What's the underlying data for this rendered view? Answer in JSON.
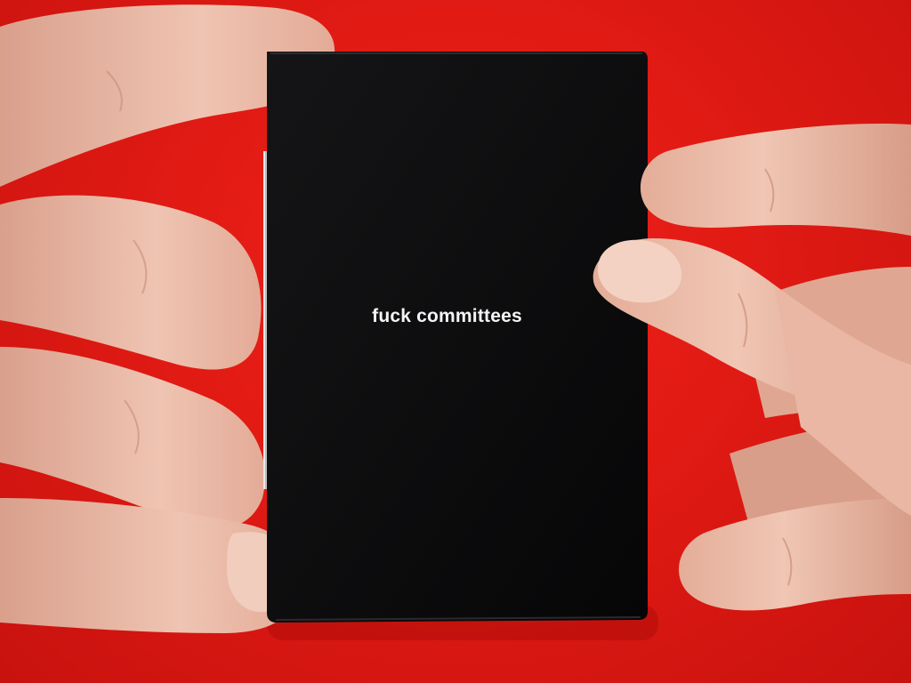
{
  "booklet": {
    "cover_text": "fuck committees"
  },
  "colors": {
    "background": "#e11a14",
    "booklet_cover": "#0d0d0f",
    "cover_text": "#f4f4f4",
    "skin": "#e8b9a6"
  }
}
